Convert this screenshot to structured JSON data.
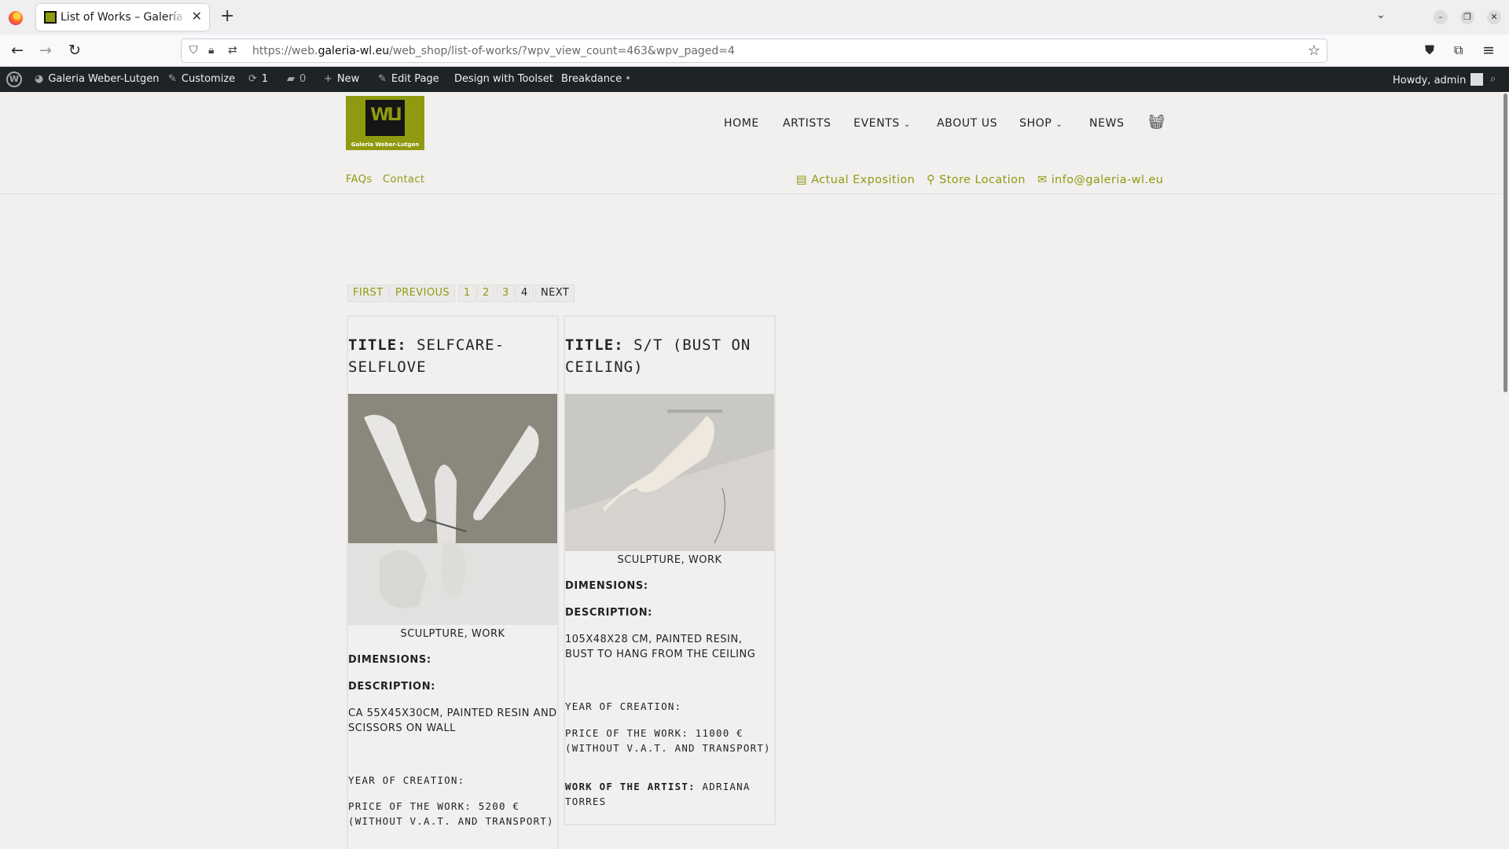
{
  "browser": {
    "tab_title": "List of Works – Galería Weber-Lutgen",
    "url_prefix": "https://web.",
    "url_domain": "galeria-wl.eu",
    "url_path": "/web_shop/list-of-works/?wpv_view_count=463&wpv_paged=4"
  },
  "wp_admin_bar": {
    "site_name": "Galeria Weber-Lutgen",
    "customize": "Customize",
    "updates_count": "1",
    "comments_count": "0",
    "new": "New",
    "edit_page": "Edit Page",
    "toolset": "Design with Toolset",
    "breakdance": "Breakdance",
    "howdy": "Howdy, admin"
  },
  "site": {
    "logo_mark": "WLI",
    "logo_text": "Galeria Weber-Lutgen",
    "nav": [
      "HOME",
      "ARTISTS",
      "EVENTS",
      "ABOUT US",
      "SHOP",
      "NEWS"
    ],
    "subnav_left": [
      "FAQs",
      "Contact"
    ],
    "subnav_right": [
      "Actual Exposition",
      "Store Location",
      "info@galeria-wl.eu"
    ]
  },
  "pagination": {
    "first": "FIRST",
    "previous": "PREVIOUS",
    "pages": [
      "1",
      "2",
      "3",
      "4"
    ],
    "current": "4",
    "next": "NEXT"
  },
  "works": [
    {
      "title_label": "TITLE:",
      "title": "SELFCARE-SELFLOVE",
      "category": "SCULPTURE, WORK",
      "dimensions_label": "DIMENSIONS:",
      "description_label": "DESCRIPTION:",
      "description": "CA 55X45X30CM, PAINTED RESIN AND SCISSORS ON WALL",
      "year_label": "YEAR OF CREATION:",
      "price": "PRICE OF THE WORK: 5200 € (WITHOUT V.A.T. AND TRANSPORT)"
    },
    {
      "title_label": "TITLE:",
      "title": "S/T (BUST ON CEILING)",
      "category": "SCULPTURE, WORK",
      "dimensions_label": "DIMENSIONS:",
      "description_label": "DESCRIPTION:",
      "description": "105X48X28 CM, PAINTED RESIN, BUST TO HANG FROM THE CEILING",
      "year_label": "YEAR OF CREATION:",
      "price": "PRICE OF THE WORK: 11000 € (WITHOUT V.A.T. AND TRANSPORT)",
      "artist_label": "WORK OF THE ARTIST:",
      "artist": "ADRIANA TORRES"
    }
  ],
  "colors": {
    "accent": "#8f9a10",
    "wpbar": "#1d2327",
    "page_bg": "#f1f0ef"
  }
}
